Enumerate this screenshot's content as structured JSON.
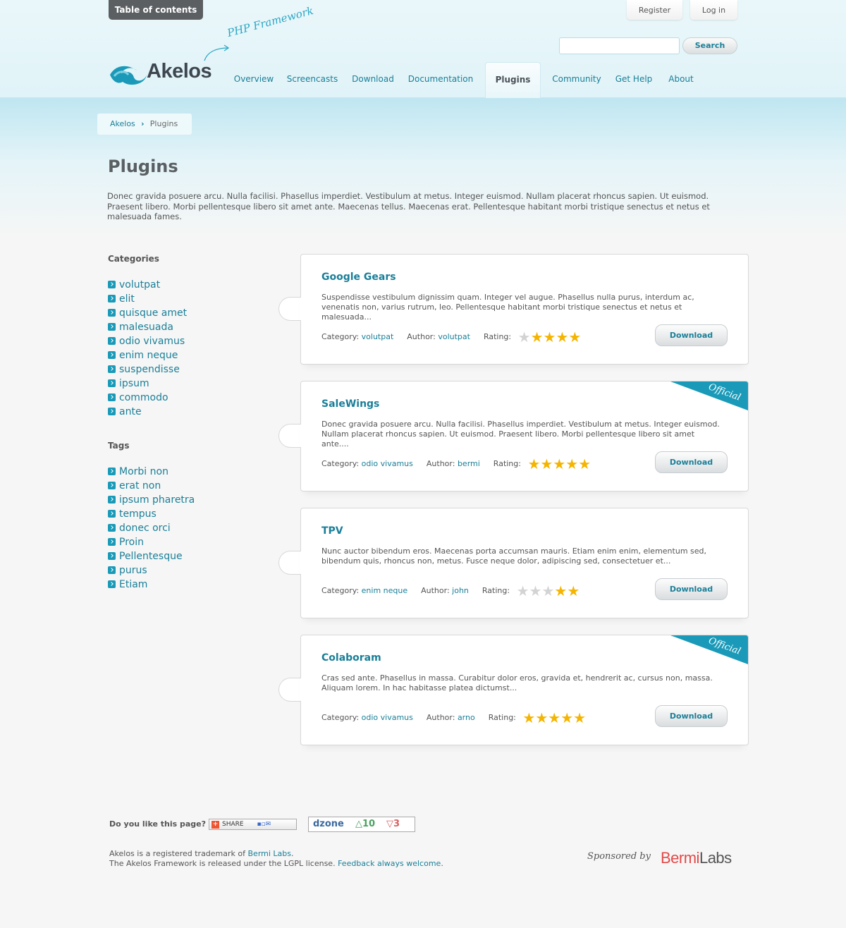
{
  "header": {
    "toc_label": "Table of contents",
    "register_label": "Register",
    "login_label": "Log in",
    "search_placeholder": "",
    "search_label": "Search",
    "logo_text": "Akelos",
    "tagline": "PHP Framework",
    "nav": [
      "Overview",
      "Screencasts",
      "Download",
      "Documentation",
      "Plugins",
      "Community",
      "Get Help",
      "About"
    ],
    "active_nav": "Plugins"
  },
  "breadcrumb": {
    "root": "Akelos",
    "current": "Plugins"
  },
  "page": {
    "title": "Plugins",
    "intro": "Donec gravida posuere arcu. Nulla facilisi. Phasellus imperdiet. Vestibulum at metus. Integer euismod. Nullam placerat rhoncus sapien. Ut euismod. Praesent libero. Morbi pellentesque libero sit amet ante. Maecenas tellus. Maecenas erat. Pellentesque habitant morbi tristique senectus et netus et malesuada fames."
  },
  "sidebar": {
    "categories_heading": "Categories",
    "categories": [
      "volutpat",
      "elit",
      "quisque amet",
      "malesuada",
      "odio vivamus",
      "enim neque",
      "suspendisse",
      "ipsum",
      "commodo",
      "ante"
    ],
    "tags_heading": "Tags",
    "tags": [
      "Morbi non",
      "erat non",
      "ipsum pharetra",
      "tempus",
      "donec orci",
      "Proin",
      "Pellentesque",
      "purus",
      "Etiam"
    ]
  },
  "labels": {
    "category": "Category:",
    "author": "Author:",
    "rating": "Rating:",
    "download": "Download",
    "official": "Official"
  },
  "plugins": [
    {
      "name": "Google Gears",
      "description": "Suspendisse vestibulum dignissim quam. Integer vel augue. Phasellus nulla purus, interdum ac, venenatis non, varius rutrum, leo. Pellentesque habitant morbi tristique senectus et netus et malesuada...",
      "category": "volutpat",
      "author": "volutpat",
      "rating": 4,
      "official": false
    },
    {
      "name": "SaleWings",
      "description": "Donec gravida posuere arcu. Nulla facilisi. Phasellus imperdiet. Vestibulum at metus. Integer euismod. Nullam placerat rhoncus sapien. Ut euismod. Praesent libero. Morbi pellentesque libero sit amet ante....",
      "category": "odio vivamus",
      "author": "bermi",
      "rating": 5,
      "official": true
    },
    {
      "name": "TPV",
      "description": "Nunc auctor bibendum eros. Maecenas porta accumsan mauris. Etiam enim enim, elementum sed, bibendum quis, rhoncus non, metus. Fusce neque dolor, adipiscing sed, consectetuer et...",
      "category": "enim neque",
      "author": "john",
      "rating": 2,
      "official": false
    },
    {
      "name": "Colaboram",
      "description": "Cras sed ante. Phasellus in massa. Curabitur dolor eros, gravida et, hendrerit ac, cursus non, massa. Aliquam lorem. In hac habitasse platea dictumst...",
      "category": "odio vivamus",
      "author": "arno",
      "rating": 5,
      "official": true
    }
  ],
  "footer": {
    "like_question": "Do you like this page?",
    "share_label": "SHARE",
    "dzone_brand": "dzone",
    "dzone_up": "10",
    "dzone_down": "3",
    "line1_prefix": "Akelos is a registered trademark of ",
    "line1_link": "Bermi Labs",
    "line1_suffix": ".",
    "line2_prefix": "The Akelos Framework is released under the LGPL license. ",
    "line2_link": "Feedback always welcome",
    "line2_suffix": ".",
    "sponsored_by": "Sponsored by",
    "sponsor_part1": "Bermi",
    "sponsor_part2": "Labs"
  },
  "colors": {
    "accent": "#1a7f98",
    "ribbon": "#1a9ab8",
    "star_on": "#f4b400",
    "star_off": "#d3d3d3"
  },
  "icons": [
    "bullet-arrow-icon",
    "star-icon",
    "breadcrumb-chevron-icon",
    "logo-wave-icon"
  ]
}
